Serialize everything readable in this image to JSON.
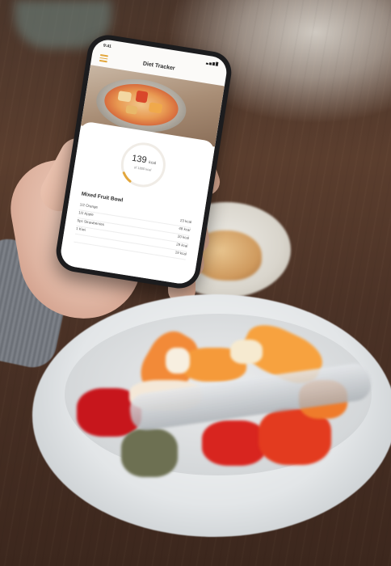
{
  "phone": {
    "status_time": "9:41",
    "app_title": "Diet Tracker",
    "calories": {
      "value": "139",
      "unit": "kcal",
      "goal": "of 1800 kcal",
      "progress": 0.08
    },
    "meal_title": "Mixed Fruit Bowl",
    "items": [
      {
        "name": "1/2 Orange",
        "kcal": "23 kcal"
      },
      {
        "name": "1/2 Apple",
        "kcal": "48 kcal"
      },
      {
        "name": "5pc Strawberries",
        "kcal": "20 kcal"
      },
      {
        "name": "1 Kiwi",
        "kcal": "29 kcal"
      },
      {
        "name": "",
        "kcal": "19 kcal"
      }
    ],
    "accent_color": "#e2a63c"
  },
  "scene": {
    "icons": [
      "menu-icon",
      "signal-icon",
      "battery-icon"
    ]
  }
}
